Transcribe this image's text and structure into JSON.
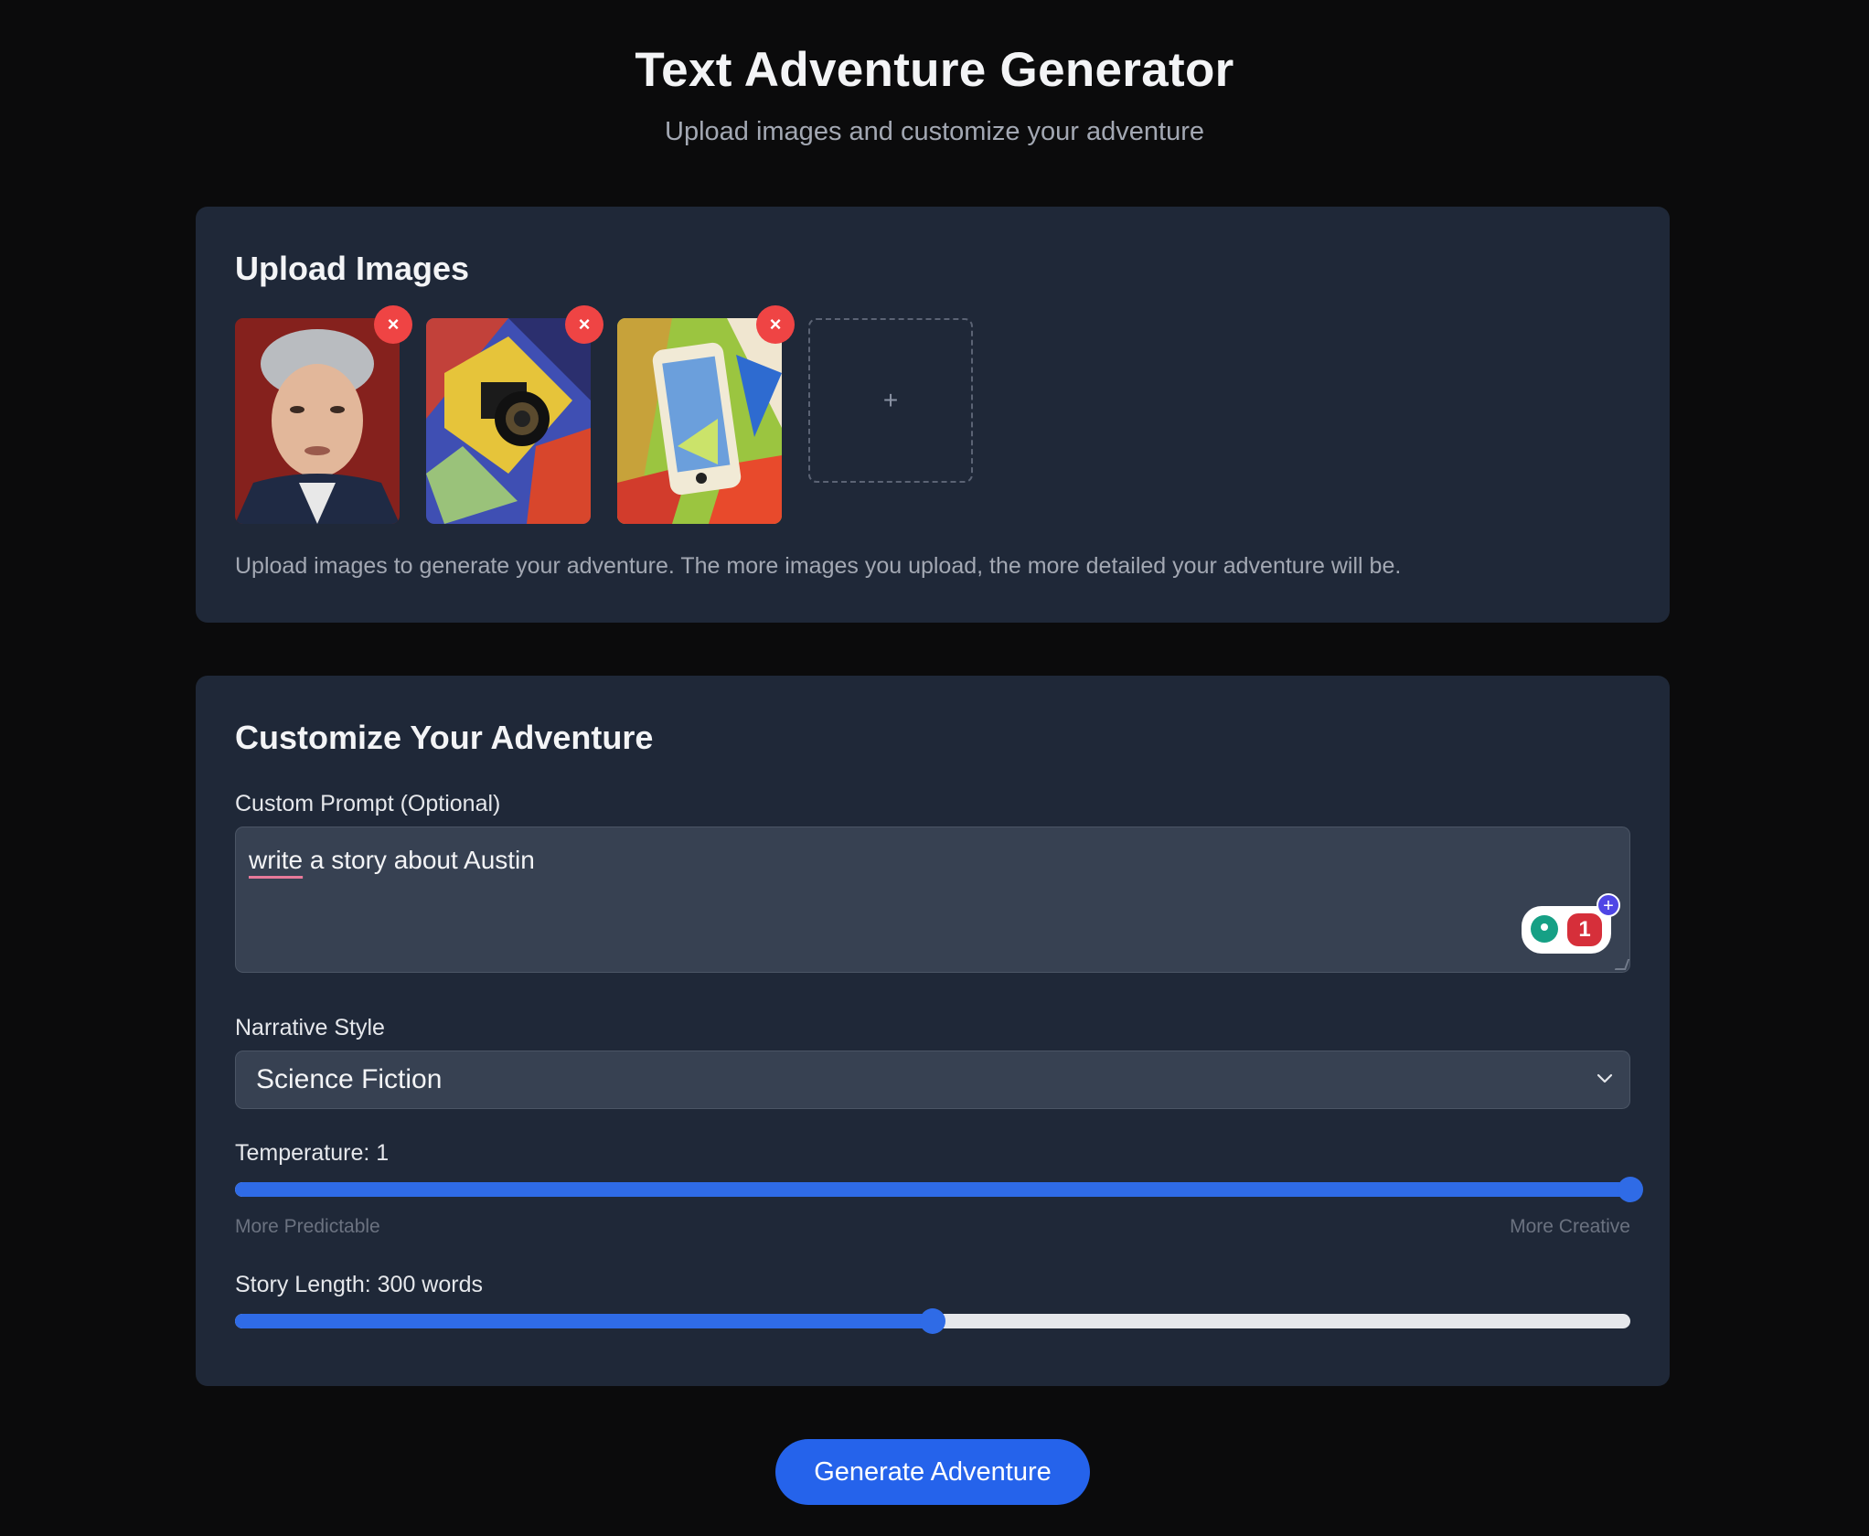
{
  "header": {
    "title": "Text Adventure Generator",
    "subtitle": "Upload images and customize your adventure"
  },
  "upload": {
    "title": "Upload Images",
    "images": [
      {
        "description_icon": "portrait-image",
        "remove_label": "×"
      },
      {
        "description_icon": "camera-cubist-image",
        "remove_label": "×"
      },
      {
        "description_icon": "phone-cubist-image",
        "remove_label": "×"
      }
    ],
    "add_label": "+",
    "help_text": "Upload images to generate your adventure. The more images you upload, the more detailed your adventure will be."
  },
  "customize": {
    "title": "Customize Your Adventure",
    "prompt_label": "Custom Prompt (Optional)",
    "prompt_value_word1": "write",
    "prompt_value_rest": " a story about Austin",
    "grammar_count": "1",
    "grammar_plus": "+",
    "style_label": "Narrative Style",
    "style_value": "Science Fiction",
    "temperature_label": "Temperature: 1",
    "temperature_value": 1,
    "temperature_min": 0,
    "temperature_max": 1,
    "temp_hint_left": "More Predictable",
    "temp_hint_right": "More Creative",
    "length_label": "Story Length: 300 words",
    "length_fraction": 0.5
  },
  "actions": {
    "generate_label": "Generate Adventure"
  },
  "colors": {
    "accent": "#2563eb",
    "remove": "#ef4444",
    "card": "#1f2838",
    "background": "#0b0b0c"
  }
}
